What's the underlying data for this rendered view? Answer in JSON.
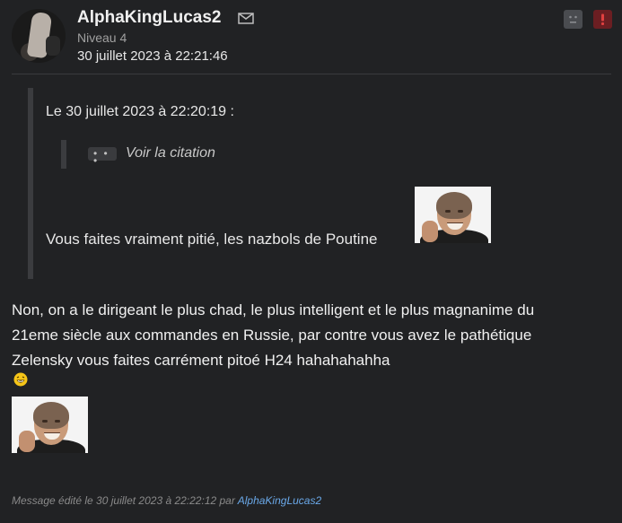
{
  "author": {
    "username": "AlphaKingLucas2",
    "level": "Niveau 4",
    "date": "30 juillet 2023 à 22:21:46"
  },
  "quote": {
    "header": "Le 30 juillet 2023 à 22:20:19 :",
    "dots_label": "• • •",
    "see_quote": "Voir la citation",
    "text": "Vous faites vraiment pitié, les nazbols de Poutine"
  },
  "message": {
    "line1": "Non, on a le dirigeant le plus chad, le plus intelligent et le plus magnanime du",
    "line2": "21eme siècle aux commandes en Russie, par contre vous avez le pathétique",
    "line3": "Zelensky vous faites carrément pitoé H24 hahahahahha"
  },
  "edit": {
    "prefix": "Message édité le 30 juillet 2023 à 22:22:12 par ",
    "user": "AlphaKingLucas2"
  },
  "icons": {
    "mail": "mail-icon",
    "sad": "sad-face-icon",
    "alert": "alert-icon",
    "laugh": "laugh-emoji-icon"
  },
  "colors": {
    "background": "#212224",
    "link": "#6aa8e8",
    "alert": "#6b1e22"
  }
}
